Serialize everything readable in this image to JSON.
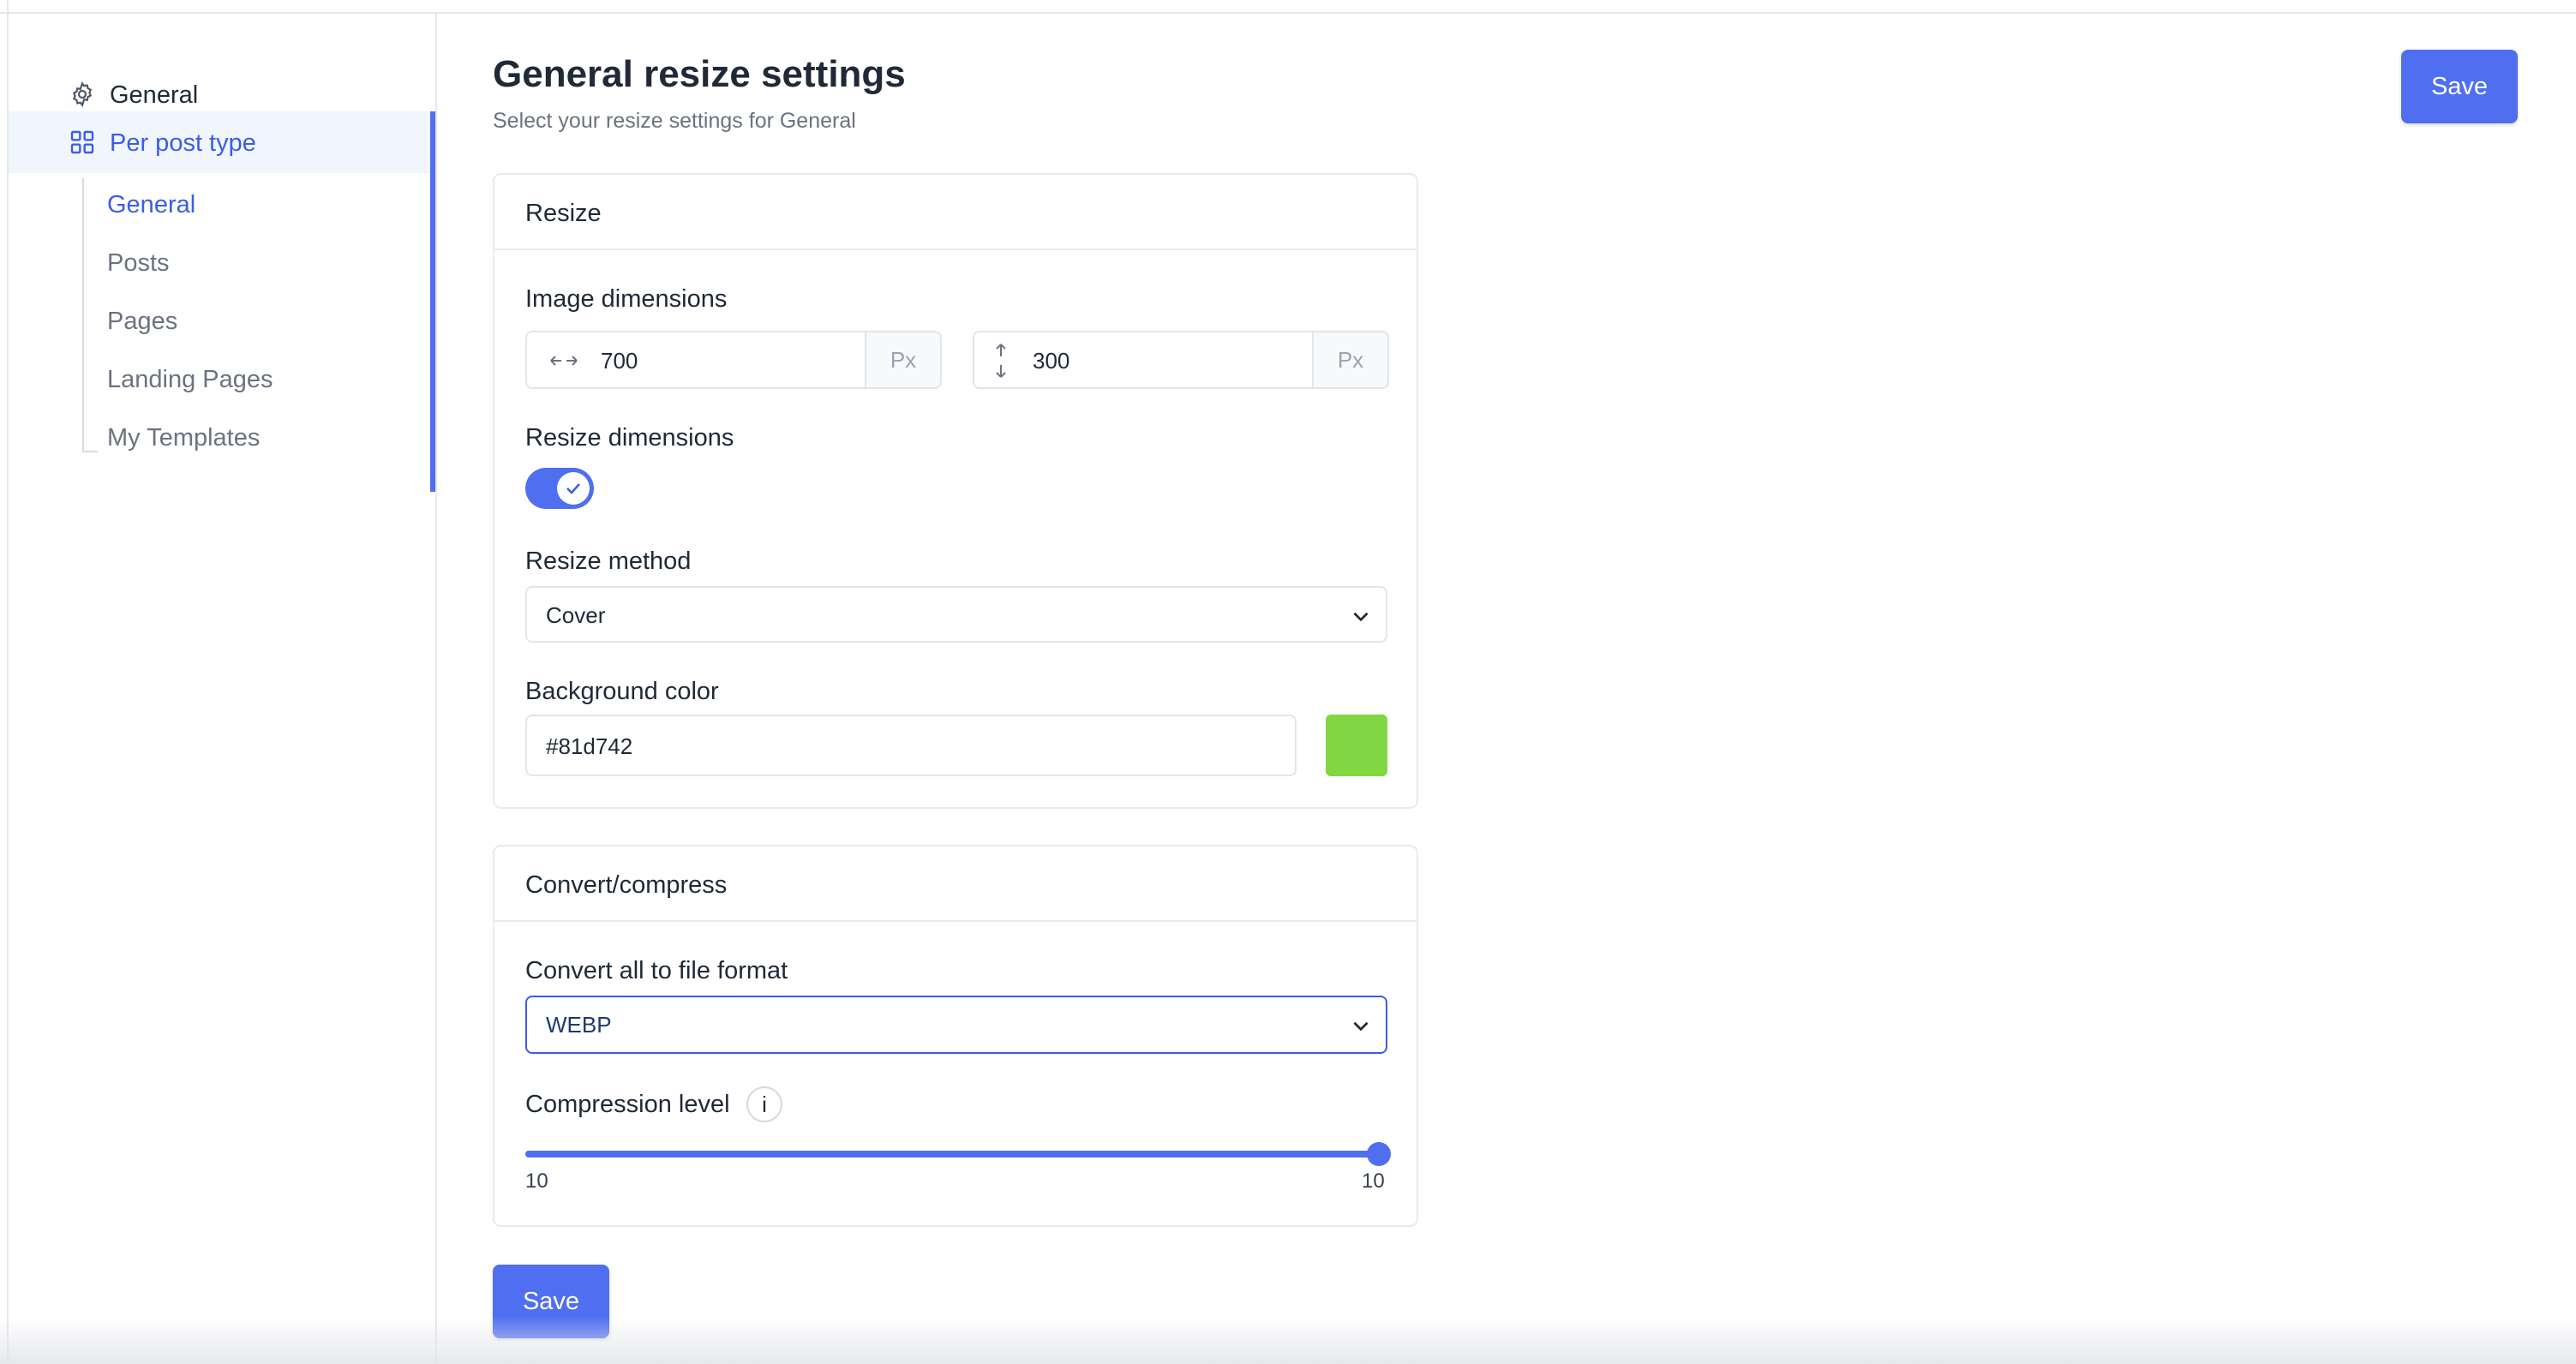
{
  "sidebar": {
    "items": [
      {
        "label": "General",
        "icon": "gear-icon"
      },
      {
        "label": "Per post type",
        "icon": "grid-icon",
        "active": true
      }
    ],
    "sub_items": [
      {
        "label": "General",
        "active": true
      },
      {
        "label": "Posts"
      },
      {
        "label": "Pages"
      },
      {
        "label": "Landing Pages"
      },
      {
        "label": "My Templates"
      }
    ]
  },
  "header": {
    "title": "General resize settings",
    "subtitle": "Select your resize settings for General",
    "save_label": "Save"
  },
  "resize_card": {
    "title": "Resize",
    "image_dimensions": {
      "label": "Image dimensions",
      "width": "700",
      "height": "300",
      "unit": "Px"
    },
    "resize_dimensions": {
      "label": "Resize dimensions",
      "enabled": true
    },
    "resize_method": {
      "label": "Resize method",
      "value": "Cover"
    },
    "background_color": {
      "label": "Background color",
      "value": "#81d742",
      "swatch": "#81d742"
    }
  },
  "convert_card": {
    "title": "Convert/compress",
    "file_format": {
      "label": "Convert all to file format",
      "value": "WEBP"
    },
    "compression": {
      "label": "Compression level",
      "info": "i",
      "min_label": "10",
      "value_label": "10",
      "value": 10
    }
  },
  "footer": {
    "save_label": "Save"
  },
  "colors": {
    "accent": "#4f6ef0",
    "active_text": "#3b5de7"
  }
}
